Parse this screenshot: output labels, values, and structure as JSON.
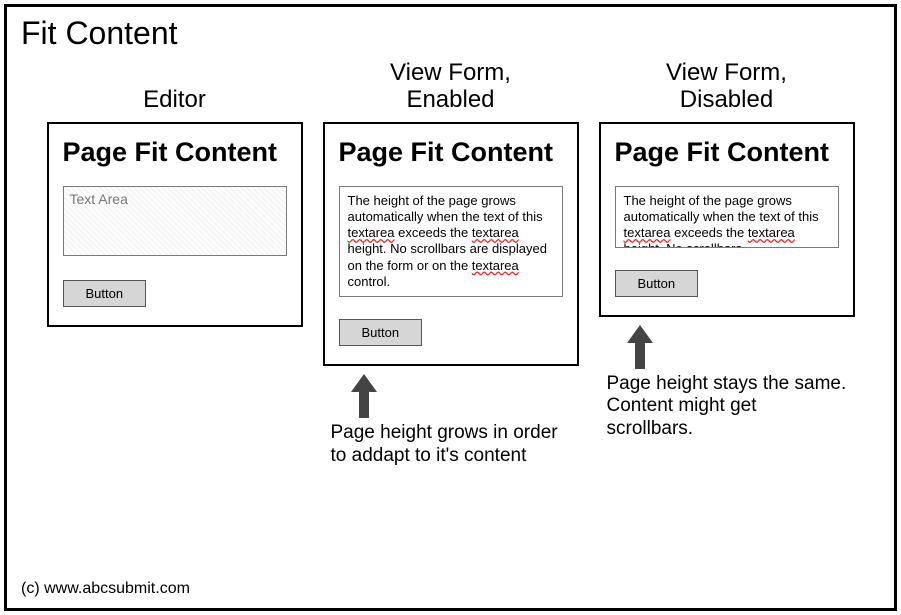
{
  "title": "Fit Content",
  "footer": "(c) www.abcsubmit.com",
  "columns": {
    "editor": {
      "label": "Editor",
      "panel_title": "Page Fit Content",
      "placeholder": "Text Area",
      "button": "Button"
    },
    "enabled": {
      "label": "View Form,\nEnabled",
      "panel_title": "Page Fit Content",
      "text_plain": "The height of the page grows automatically when the text of this textarea exceeds the textarea height. No scrollbars are displayed on the form or on the textarea control.",
      "button": "Button",
      "caption": "Page height grows in order to addapt to it's content"
    },
    "disabled": {
      "label": "View Form,\nDisabled",
      "panel_title": "Page Fit Content",
      "text_plain": "The height of the page grows automatically when the text of this textarea exceeds the textarea height. No scrollbars",
      "button": "Button",
      "caption": "Page height stays the same. Content might get scrollbars."
    }
  }
}
